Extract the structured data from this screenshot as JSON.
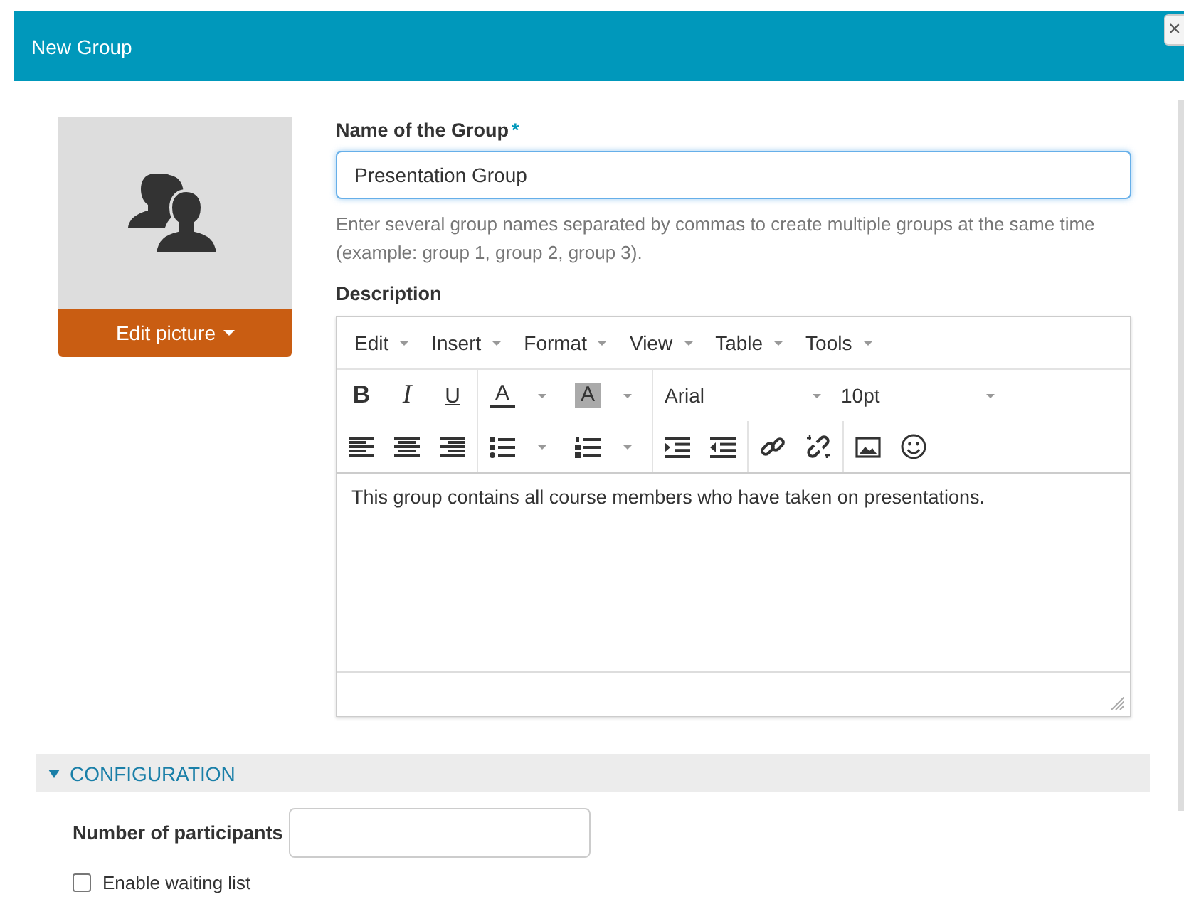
{
  "dialog": {
    "title": "New Group",
    "close": "×"
  },
  "picture": {
    "button": "Edit picture"
  },
  "name_field": {
    "label": "Name of the Group",
    "required_mark": "*",
    "value": "Presentation Group",
    "focused": true,
    "help": "Enter several group names separated by commas to create multiple groups at the same time (example: group 1, group 2, group 3)."
  },
  "description": {
    "label": "Description",
    "menus": [
      "Edit",
      "Insert",
      "Format",
      "View",
      "Table",
      "Tools"
    ],
    "format_buttons": [
      "B",
      "I",
      "U"
    ],
    "color_buttons": [
      {
        "label": "A",
        "kind": "text-color"
      },
      {
        "label": "A",
        "kind": "background-color"
      }
    ],
    "font": "Arial",
    "size": "10pt",
    "content": "This group contains all course members who have taken on presentations."
  },
  "configuration": {
    "title": "CONFIGURATION",
    "expanded": true,
    "participants_label": "Number of participants",
    "waiting_list": {
      "label": "Enable waiting list",
      "checked": false
    }
  }
}
